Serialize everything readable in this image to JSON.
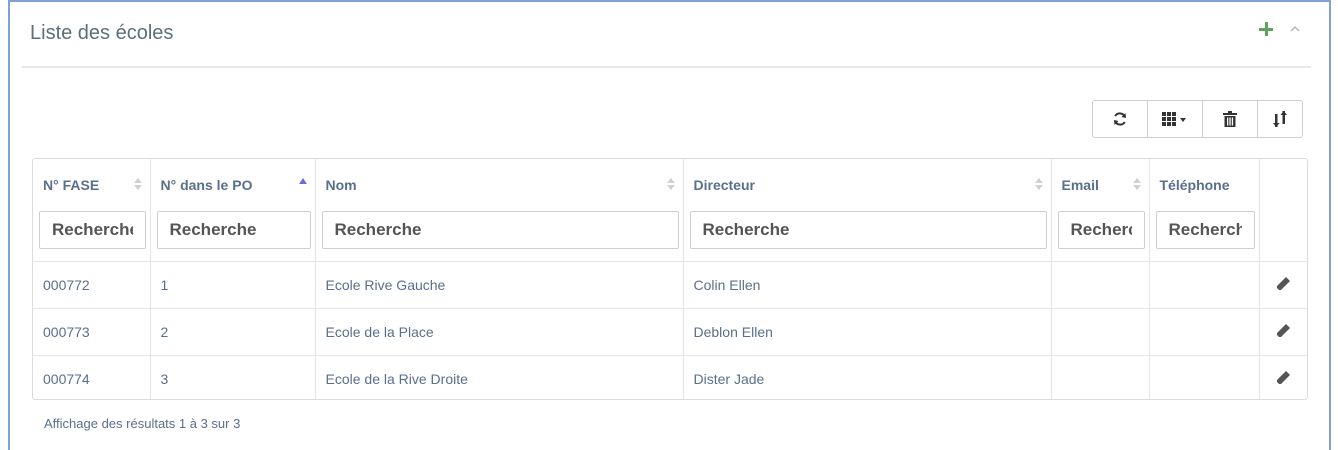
{
  "panel": {
    "title": "Liste des écoles",
    "accent_color": "#5fa35f",
    "border_color": "#7fa2cf"
  },
  "toolbar": {
    "buttons": [
      {
        "name": "refresh-button",
        "icon": "refresh-icon"
      },
      {
        "name": "columns-button",
        "icon": "columns-grid-icon"
      },
      {
        "name": "delete-button",
        "icon": "trash-icon"
      },
      {
        "name": "sort-button",
        "icon": "sort-arrows-icon"
      }
    ]
  },
  "table": {
    "columns": [
      {
        "label": "N° FASE",
        "sort": "none",
        "filter_placeholder": "Recherche"
      },
      {
        "label": "N° dans le PO",
        "sort": "asc",
        "filter_placeholder": "Recherche"
      },
      {
        "label": "Nom",
        "sort": "none",
        "filter_placeholder": "Recherche"
      },
      {
        "label": "Directeur",
        "sort": "none",
        "filter_placeholder": "Recherche"
      },
      {
        "label": "Email",
        "sort": "none",
        "filter_placeholder": "Recherche"
      },
      {
        "label": "Téléphone",
        "sort": "none",
        "filter_placeholder": "Recherche"
      }
    ],
    "rows": [
      {
        "fase": "000772",
        "po": "1",
        "nom": "Ecole Rive Gauche",
        "directeur": "Colin Ellen",
        "email": "",
        "telephone": ""
      },
      {
        "fase": "000773",
        "po": "2",
        "nom": "Ecole de la Place",
        "directeur": "Deblon Ellen",
        "email": "",
        "telephone": ""
      },
      {
        "fase": "000774",
        "po": "3",
        "nom": "Ecole de la Rive Droite",
        "directeur": "Dister Jade",
        "email": "",
        "telephone": ""
      }
    ]
  },
  "footer": {
    "summary": "Affichage des résultats 1 à 3 sur 3"
  }
}
